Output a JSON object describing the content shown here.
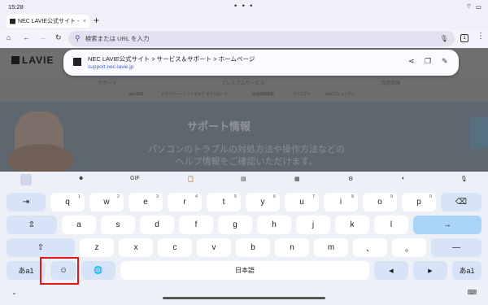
{
  "status": {
    "time": "15:28",
    "dots": "• • •",
    "battery": "100%"
  },
  "tab": {
    "title": "NEC LAVIE公式サイト -",
    "close": "×",
    "new": "+"
  },
  "toolbar": {
    "placeholder": "検索または URL を入力",
    "tab_count": "1"
  },
  "page": {
    "logo": "LAVIE",
    "logo_prefix": "NEC",
    "nav": [
      "サポート",
      "プレミアムサービス",
      "活用情報"
    ],
    "subnav": [
      "Q&A検索",
      "ドライバー・ソフトウェア ダウンロード",
      "商品情報検索",
      "マニュアル",
      "Q&Aコミュニティ"
    ],
    "hero_title": "サポート情報",
    "hero_sub": "パソコンのトラブルの対処方法や操作方法などの ヘルプ情報をご確認いただけます。"
  },
  "popup": {
    "title": "NEC LAVIE公式サイト > サービス＆サポート > ホームページ",
    "url": "support.nec-lavie.jp"
  },
  "keyboard": {
    "toolbar": {
      "gif": "GIF"
    },
    "row1": [
      {
        "k": "q",
        "s": "1"
      },
      {
        "k": "w",
        "s": "2"
      },
      {
        "k": "e",
        "s": "3"
      },
      {
        "k": "r",
        "s": "4"
      },
      {
        "k": "t",
        "s": "5"
      },
      {
        "k": "y",
        "s": "6"
      },
      {
        "k": "u",
        "s": "7"
      },
      {
        "k": "i",
        "s": "8"
      },
      {
        "k": "o",
        "s": "9"
      },
      {
        "k": "p",
        "s": "0"
      }
    ],
    "row2": [
      "a",
      "s",
      "d",
      "f",
      "g",
      "h",
      "j",
      "k",
      "l"
    ],
    "row3": [
      "z",
      "x",
      "c",
      "v",
      "b",
      "n",
      "m",
      "、",
      "。"
    ],
    "tab": "⇥",
    "caps": "⇬",
    "shift": "⇧",
    "backspace": "⌫",
    "enter": "→",
    "dash": "—",
    "lang_left": "あa1",
    "lang_right": "あa1",
    "emoji": "☺",
    "globe": "🌐",
    "space": "日本語",
    "left": "◀",
    "right": "▶"
  },
  "navbar": {
    "chevron": "⌄",
    "kb": "⌨"
  }
}
